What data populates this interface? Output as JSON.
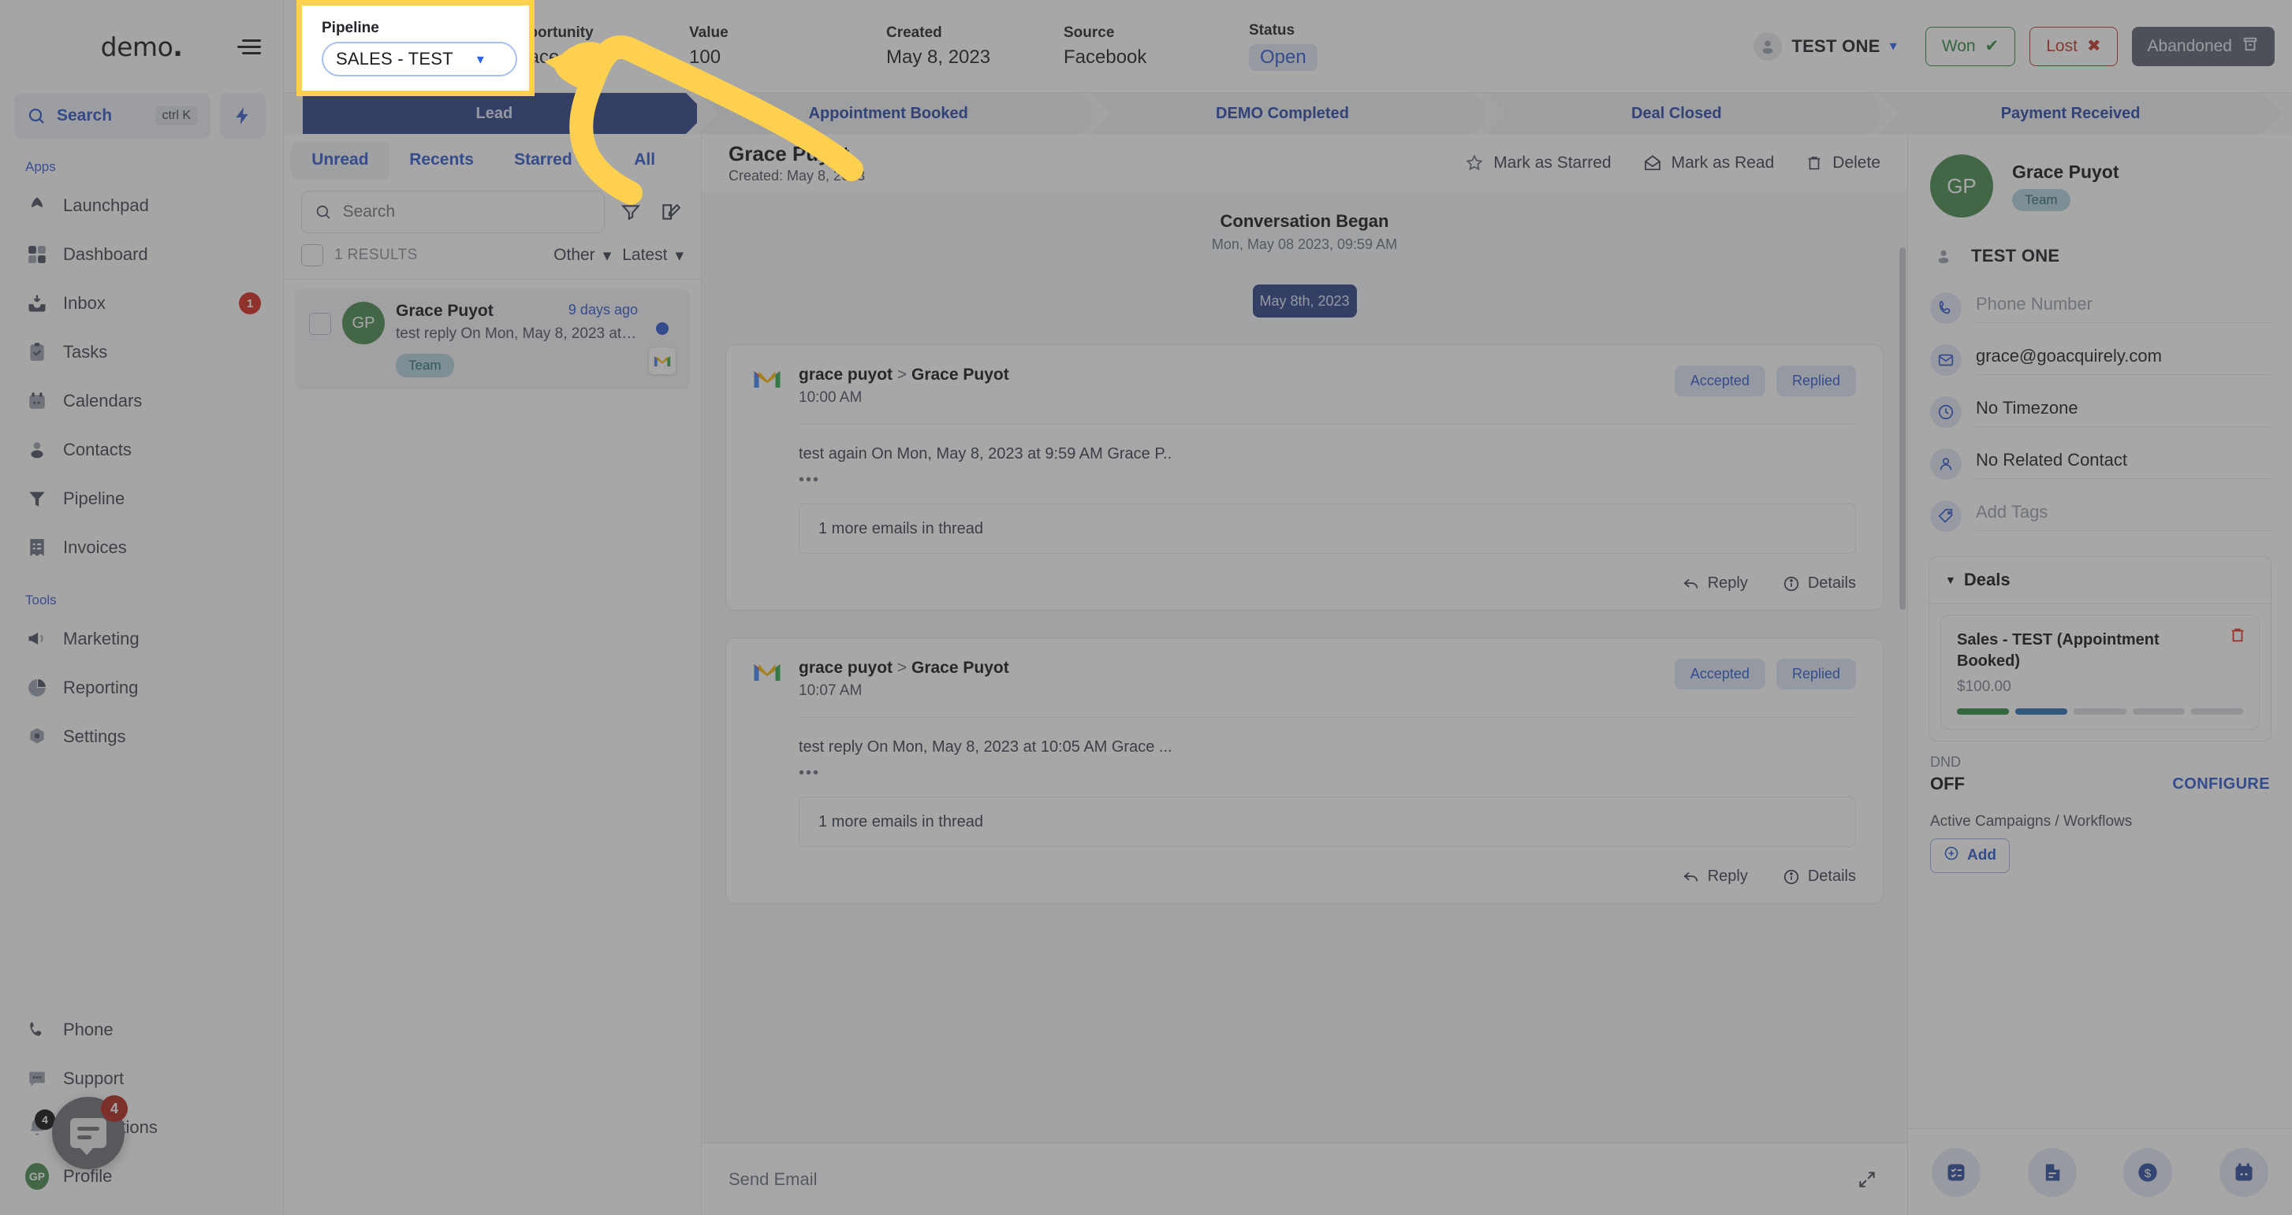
{
  "sidebar": {
    "logo": "demo",
    "search": {
      "label": "Search",
      "shortcut": "ctrl K"
    },
    "sections": [
      {
        "title": "Apps",
        "items": [
          {
            "label": "Launchpad",
            "icon": "launchpad-icon",
            "badge": ""
          },
          {
            "label": "Dashboard",
            "icon": "dashboard-icon",
            "badge": ""
          },
          {
            "label": "Inbox",
            "icon": "inbox-icon",
            "badge": "1"
          },
          {
            "label": "Tasks",
            "icon": "tasks-icon",
            "badge": ""
          },
          {
            "label": "Calendars",
            "icon": "calendar-icon",
            "badge": ""
          },
          {
            "label": "Contacts",
            "icon": "contacts-icon",
            "badge": ""
          },
          {
            "label": "Pipeline",
            "icon": "pipeline-icon",
            "badge": ""
          },
          {
            "label": "Invoices",
            "icon": "invoices-icon",
            "badge": ""
          }
        ]
      },
      {
        "title": "Tools",
        "items": [
          {
            "label": "Marketing",
            "icon": "megaphone-icon",
            "badge": ""
          },
          {
            "label": "Reporting",
            "icon": "pie-chart-icon",
            "badge": ""
          },
          {
            "label": "Settings",
            "icon": "gear-icon",
            "badge": ""
          }
        ]
      }
    ],
    "bottom": [
      {
        "label": "Phone",
        "icon": "phone-icon",
        "badge": ""
      },
      {
        "label": "Support",
        "icon": "support-icon",
        "badge": ""
      },
      {
        "label": "Notifications",
        "icon": "bell-icon",
        "badge": "4"
      },
      {
        "label": "Profile",
        "icon": "avatar-icon",
        "badge": ""
      }
    ],
    "profile_initials": "GP",
    "chat_badge": "4"
  },
  "opportunity_header": {
    "pipeline_label": "Pipeline",
    "pipeline_value": "SALES - TEST",
    "fields": [
      {
        "key": "Opportunity",
        "value": "Grace Puyot"
      },
      {
        "key": "Value",
        "value": "100"
      },
      {
        "key": "Created",
        "value": "May 8, 2023"
      },
      {
        "key": "Source",
        "value": "Facebook"
      },
      {
        "key": "Status",
        "value": "Open"
      }
    ],
    "owner": "TEST ONE",
    "won_label": "Won",
    "lost_label": "Lost",
    "abandoned_label": "Abandoned"
  },
  "stages": [
    {
      "label": "Lead",
      "active": true
    },
    {
      "label": "Appointment Booked",
      "active": false
    },
    {
      "label": "DEMO Completed",
      "active": false
    },
    {
      "label": "Deal Closed",
      "active": false
    },
    {
      "label": "Payment Received",
      "active": false
    }
  ],
  "conversation_list": {
    "tabs": [
      {
        "label": "Unread",
        "active": true
      },
      {
        "label": "Recents",
        "active": false
      },
      {
        "label": "Starred",
        "active": false
      },
      {
        "label": "All",
        "active": false
      }
    ],
    "search_placeholder": "Search",
    "results_count": "1 RESULTS",
    "filter_label": "Other",
    "sort_label": "Latest",
    "items": [
      {
        "initials": "GP",
        "name": "Grace Puyot",
        "time_ago": "9 days ago",
        "snippet": "test reply On Mon, May 8, 2023 at ...",
        "tag": "Team",
        "channel": "gmail"
      }
    ]
  },
  "conversation": {
    "title": "Grace Puyot",
    "created": "Created: May 8, 2023",
    "actions": [
      {
        "label": "Mark as Starred",
        "icon": "star-icon"
      },
      {
        "label": "Mark as Read",
        "icon": "envelope-open-icon"
      },
      {
        "label": "Delete",
        "icon": "trash-icon"
      }
    ],
    "began_title": "Conversation Began",
    "began_time": "Mon, May 08 2023, 09:59 AM",
    "date_pill": "May 8th, 2023",
    "messages": [
      {
        "from": "grace puyot",
        "to": "Grace Puyot",
        "time": "10:00 AM",
        "chips": [
          "Accepted",
          "Replied"
        ],
        "body": "test again On Mon, May 8, 2023 at 9:59 AM Grace P..",
        "more": "1 more emails in thread",
        "reply_label": "Reply",
        "details_label": "Details"
      },
      {
        "from": "grace puyot",
        "to": "Grace Puyot",
        "time": "10:07 AM",
        "chips": [
          "Accepted",
          "Replied"
        ],
        "body": "test reply On Mon, May 8, 2023 at 10:05 AM Grace ...",
        "more": "1 more emails in thread",
        "reply_label": "Reply",
        "details_label": "Details"
      }
    ],
    "send_placeholder": "Send Email"
  },
  "contact_panel": {
    "initials": "GP",
    "name": "Grace Puyot",
    "tag": "Team",
    "owner": "TEST ONE",
    "phone_placeholder": "Phone Number",
    "email": "grace@goacquirely.com",
    "timezone": "No Timezone",
    "related_contact": "No Related Contact",
    "tags_placeholder": "Add Tags",
    "deals_title": "Deals",
    "deal": {
      "name": "Sales - TEST (Appointment Booked)",
      "amount": "$100.00",
      "progress_filled": 2,
      "progress_total": 5
    },
    "dnd_label": "DND",
    "dnd_value": "OFF",
    "configure_label": "CONFIGURE",
    "campaigns_label": "Active Campaigns / Workflows",
    "add_label": "Add",
    "footer_icons": [
      "tasks-icon",
      "notes-icon",
      "payments-icon",
      "appointments-icon"
    ]
  },
  "colors": {
    "accent_blue": "#2f5ad0",
    "stage_active": "#2e4288",
    "won_green": "#2f8a43",
    "lost_red": "#c0392b",
    "highlight_yellow": "#fdd14f",
    "avatar_green": "#4a8a4f"
  }
}
